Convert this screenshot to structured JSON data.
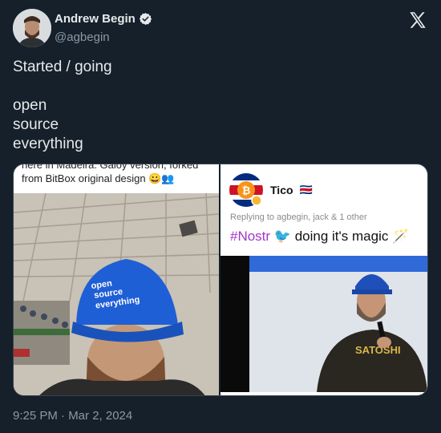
{
  "author": {
    "name": "Andrew Begin",
    "handle": "@agbegin",
    "verified": true
  },
  "post": {
    "lines": [
      "Started / going",
      "",
      "open",
      "source",
      "everything"
    ]
  },
  "media": {
    "left": {
      "caption_cut": "here in Madeira. Galoy version, forked",
      "caption_line2": "from BitBox original design 😀👥",
      "cap_text": [
        "open",
        "source",
        "everything"
      ]
    },
    "right": {
      "username": "Tico",
      "flag": "🇨🇷",
      "replying": "Replying to agbegin, jack & 1 other",
      "hashtag": "#Nostr",
      "message_rest": " doing it's magic",
      "shirt_text": "SATOSHI"
    }
  },
  "timestamp": "9:25 PM · Mar 2, 2024",
  "colors": {
    "background": "#15202b",
    "text": "#e7e9ea",
    "muted": "#8b98a5",
    "verified": "#e7e9ea",
    "hashtag": "#a335c9",
    "cap_blue": "#1f5fd6"
  }
}
